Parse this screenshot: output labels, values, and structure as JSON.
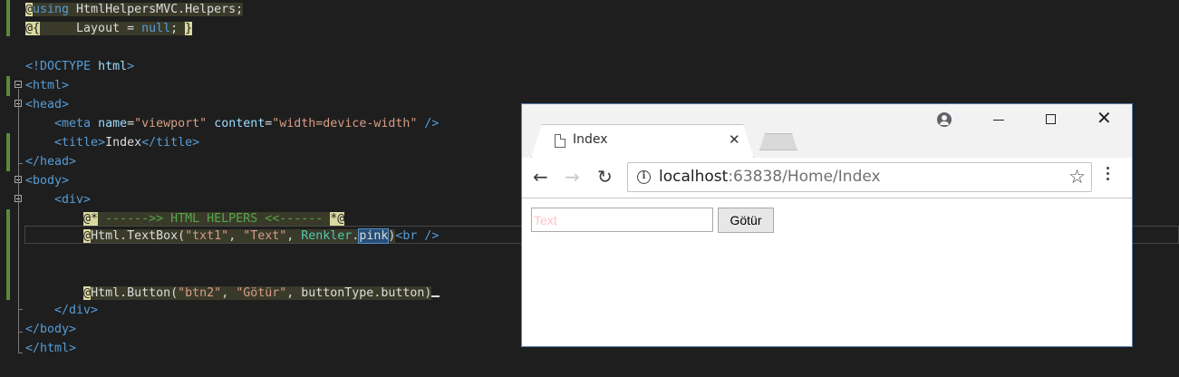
{
  "editor": {
    "lines": [
      "@using HtmlHelpersMVC.Helpers;",
      "@{     Layout = null; }",
      "",
      "<!DOCTYPE html>",
      "<html>",
      "<head>",
      "    <meta name=\"viewport\" content=\"width=device-width\" />",
      "    <title>Index</title>",
      "</head>",
      "<body>",
      "    <div>",
      "        @* ------>> HTML HELPERS <<------ *@",
      "        @Html.TextBox(\"txt1\", \"Text\", Renkler.pink)<br />",
      "",
      "",
      "        @Html.Button(\"btn2\", \"Götür\", buttonType.button)",
      "    </div>",
      "</body>",
      "</html>"
    ]
  },
  "browser": {
    "tab_title": "Index",
    "url_host": "localhost",
    "url_rest": ":63838/Home/Index",
    "icons": {
      "back": "←",
      "forward": "→",
      "reload": "↻",
      "info": "i",
      "star": "☆",
      "tab_close": "✕",
      "win_close": "✕"
    },
    "page": {
      "textbox_value": "Text",
      "textbox_color": "#ffc0cb",
      "button_label": "Götür"
    }
  },
  "colors": {
    "editor_bg": "#1e1e1e",
    "keyword": "#569cd6",
    "string": "#d69d85",
    "comment": "#57a64a",
    "razor_at": "#dadaa0"
  }
}
